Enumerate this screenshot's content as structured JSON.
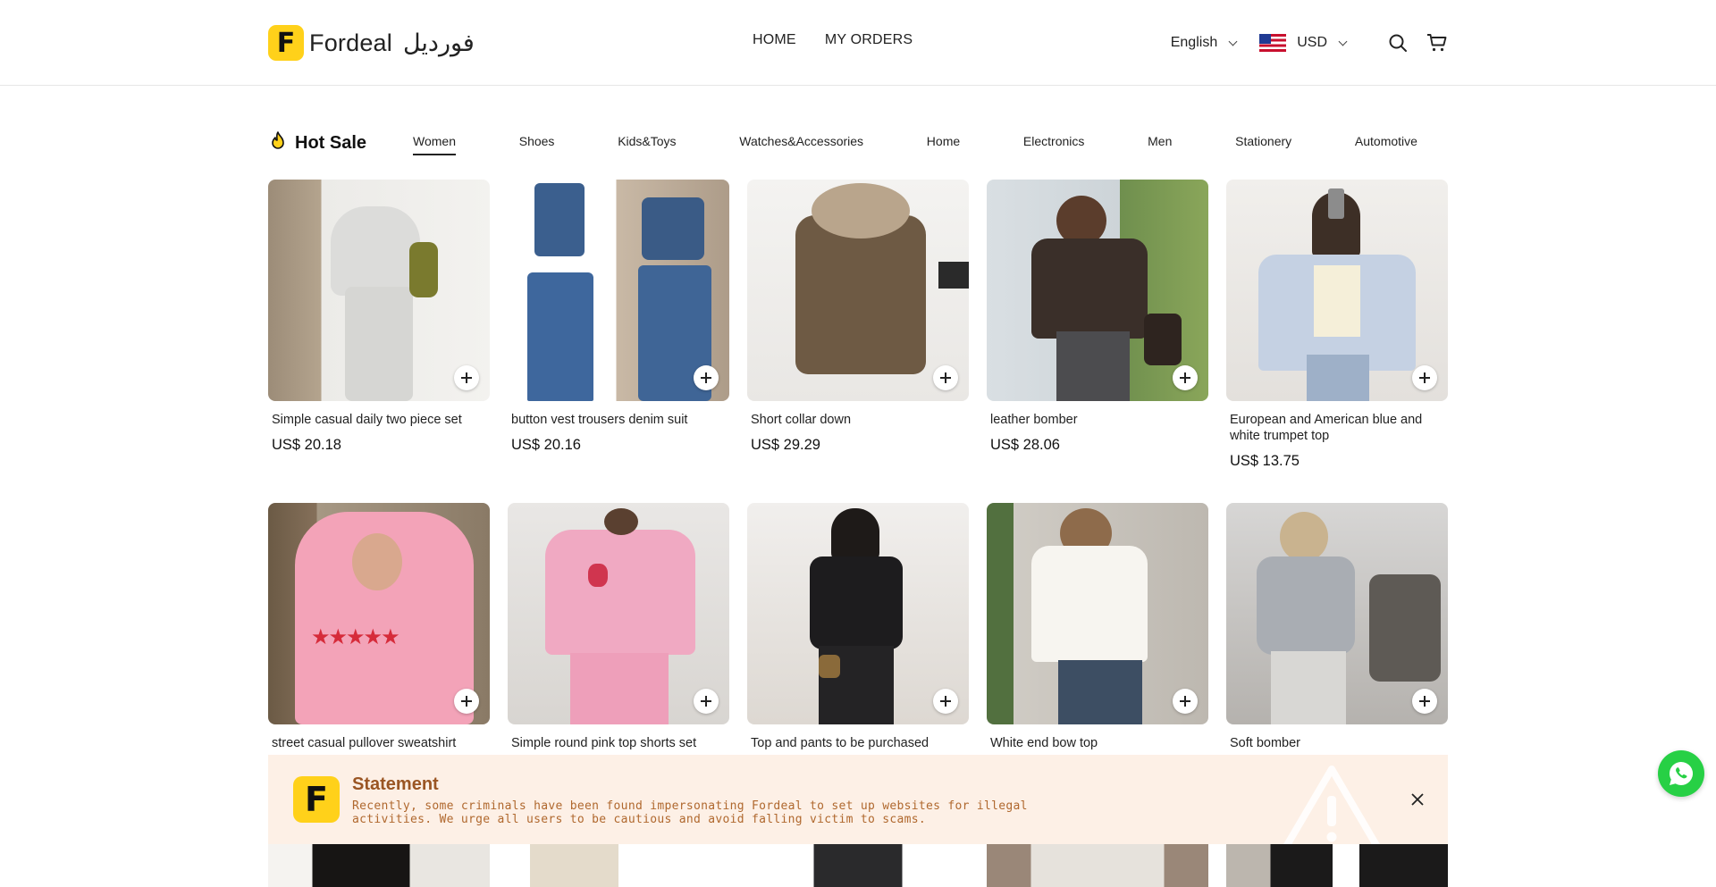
{
  "header": {
    "logo_latin": "Fordeal",
    "logo_arabic": "فورديل",
    "logo_mark": "F",
    "nav": [
      "HOME",
      "MY ORDERS"
    ],
    "language": "English",
    "currency": "USD",
    "icons": [
      "chevron-down-icon",
      "us-flag-icon",
      "search-icon",
      "cart-icon"
    ]
  },
  "hot_sale": {
    "title": "Hot Sale",
    "icon": "flame-icon",
    "tabs": [
      "Women",
      "Shoes",
      "Kids&Toys",
      "Watches&Accessories",
      "Home",
      "Electronics",
      "Men",
      "Stationery",
      "Automotive"
    ],
    "active_tab": "Women"
  },
  "products": [
    {
      "name": "Simple casual daily two piece set",
      "price": "US$ 20.18"
    },
    {
      "name": "button vest trousers denim suit",
      "price": "US$ 20.16"
    },
    {
      "name": "Short collar down",
      "price": "US$ 29.29"
    },
    {
      "name": "leather bomber",
      "price": "US$ 28.06"
    },
    {
      "name": "European and American blue and white trumpet top",
      "price": "US$ 13.75"
    },
    {
      "name": "street casual pullover sweatshirt",
      "price": ""
    },
    {
      "name": "Simple round pink top shorts set",
      "price": ""
    },
    {
      "name": "Top and pants to be purchased separately Comfortable casual dat",
      "price": ""
    },
    {
      "name": "White end bow top",
      "price": ""
    },
    {
      "name": "Soft bomber",
      "price": ""
    }
  ],
  "statement": {
    "logo_mark": "F",
    "title": "Statement",
    "text": "Recently, some criminals have been found impersonating Fordeal to set up websites for illegal activities. We urge all users to be cautious and avoid falling victim to scams."
  },
  "colors": {
    "brand_yellow": "#ffd11a",
    "statement_bg": "#fdf0e6",
    "statement_title": "#9a5523",
    "whatsapp_green": "#27d045"
  }
}
